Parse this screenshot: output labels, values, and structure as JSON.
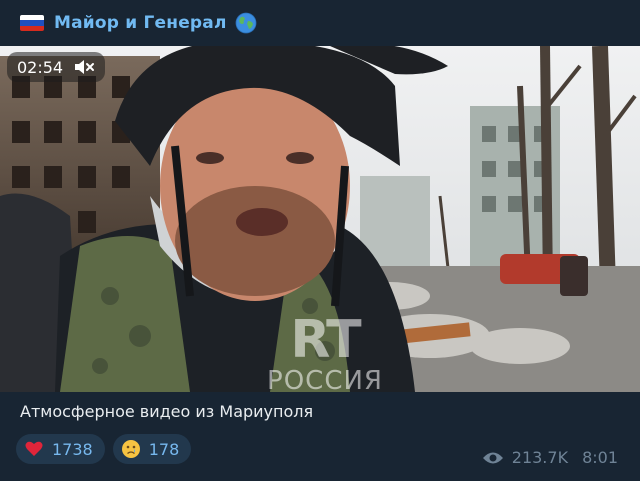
{
  "channel": {
    "name": "Майор и Генерал",
    "flag_colors": [
      "#ffffff",
      "#1f4fbf",
      "#d52b1e"
    ],
    "accent": "#71baf2"
  },
  "video": {
    "duration": "02:54",
    "muted": true,
    "watermark_logo": "RT",
    "watermark_text": "РОССИЯ"
  },
  "post": {
    "caption": "Атмосферное видео из Мариуполя",
    "reactions": [
      {
        "icon": "heart-icon",
        "count": "1738"
      },
      {
        "icon": "crying-face-icon",
        "count": "178"
      }
    ],
    "views": "213.7K",
    "time": "8:01"
  }
}
